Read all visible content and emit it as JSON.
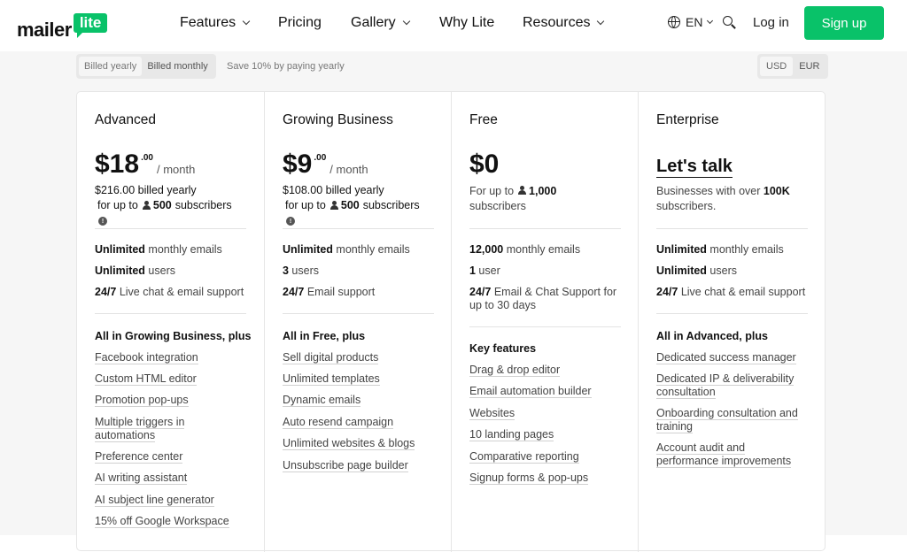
{
  "header": {
    "logo_main": "mailer",
    "logo_badge": "lite",
    "nav": [
      "Features",
      "Pricing",
      "Gallery",
      "Why Lite",
      "Resources"
    ],
    "language": "EN",
    "login": "Log in",
    "signup": "Sign up"
  },
  "toggles": {
    "billed_yearly": "Billed yearly",
    "billed_monthly": "Billed monthly",
    "save_note": "Save 10% by paying yearly",
    "usd": "USD",
    "eur": "EUR"
  },
  "plans": [
    {
      "name": "Advanced",
      "price": "$18",
      "cents": ".00",
      "period": "/ month",
      "billed": "$216.00 billed yearly",
      "for_prefix": "for up to",
      "subscribers": "500",
      "for_suffix": "subscribers",
      "limits": [
        {
          "bold": "Unlimited",
          "text": " monthly emails"
        },
        {
          "bold": "Unlimited",
          "text": " users"
        },
        {
          "bold": "24/7",
          "text": " Live chat & email support"
        }
      ],
      "features_head": "All in Growing Business, plus",
      "features": [
        "Facebook integration",
        "Custom HTML editor",
        "Promotion pop-ups",
        "Multiple triggers in automations",
        "Preference center",
        "AI writing assistant",
        "AI subject line generator",
        "15% off Google Workspace"
      ]
    },
    {
      "name": "Growing Business",
      "price": "$9",
      "cents": ".00",
      "period": "/ month",
      "billed": "$108.00 billed yearly",
      "for_prefix": "for up to",
      "subscribers": "500",
      "for_suffix": "subscribers",
      "limits": [
        {
          "bold": "Unlimited",
          "text": " monthly emails"
        },
        {
          "bold": "3",
          "text": " users"
        },
        {
          "bold": "24/7",
          "text": " Email support"
        }
      ],
      "features_head": "All in Free, plus",
      "features": [
        "Sell digital products",
        "Unlimited templates",
        "Dynamic emails",
        "Auto resend campaign",
        "Unlimited websites & blogs",
        "Unsubscribe page builder"
      ]
    },
    {
      "name": "Free",
      "price": "$0",
      "sub_prefix": "For up to",
      "sub_bold": "1,000",
      "sub_suffix": "subscribers",
      "limits": [
        {
          "bold": "12,000",
          "text": " monthly emails"
        },
        {
          "bold": "1",
          "text": " user"
        },
        {
          "bold": "24/7",
          "text": " Email & Chat Support for up to 30 days"
        }
      ],
      "features_head": "Key features",
      "features": [
        "Drag & drop editor",
        "Email automation builder",
        "Websites",
        "10 landing pages",
        "Comparative reporting",
        "Signup forms & pop-ups"
      ]
    },
    {
      "name": "Enterprise",
      "price": "Let's talk",
      "sub_prefix": "Businesses with over",
      "sub_bold": "100K",
      "sub_suffix": "subscribers.",
      "limits": [
        {
          "bold": "Unlimited",
          "text": " monthly emails"
        },
        {
          "bold": "Unlimited",
          "text": " users"
        },
        {
          "bold": "24/7",
          "text": " Live chat & email support"
        }
      ],
      "features_head": "All in Advanced, plus",
      "features": [
        "Dedicated success manager",
        "Dedicated IP & deliverability consultation",
        "Onboarding consultation and training",
        "Account audit and performance improvements"
      ]
    }
  ]
}
